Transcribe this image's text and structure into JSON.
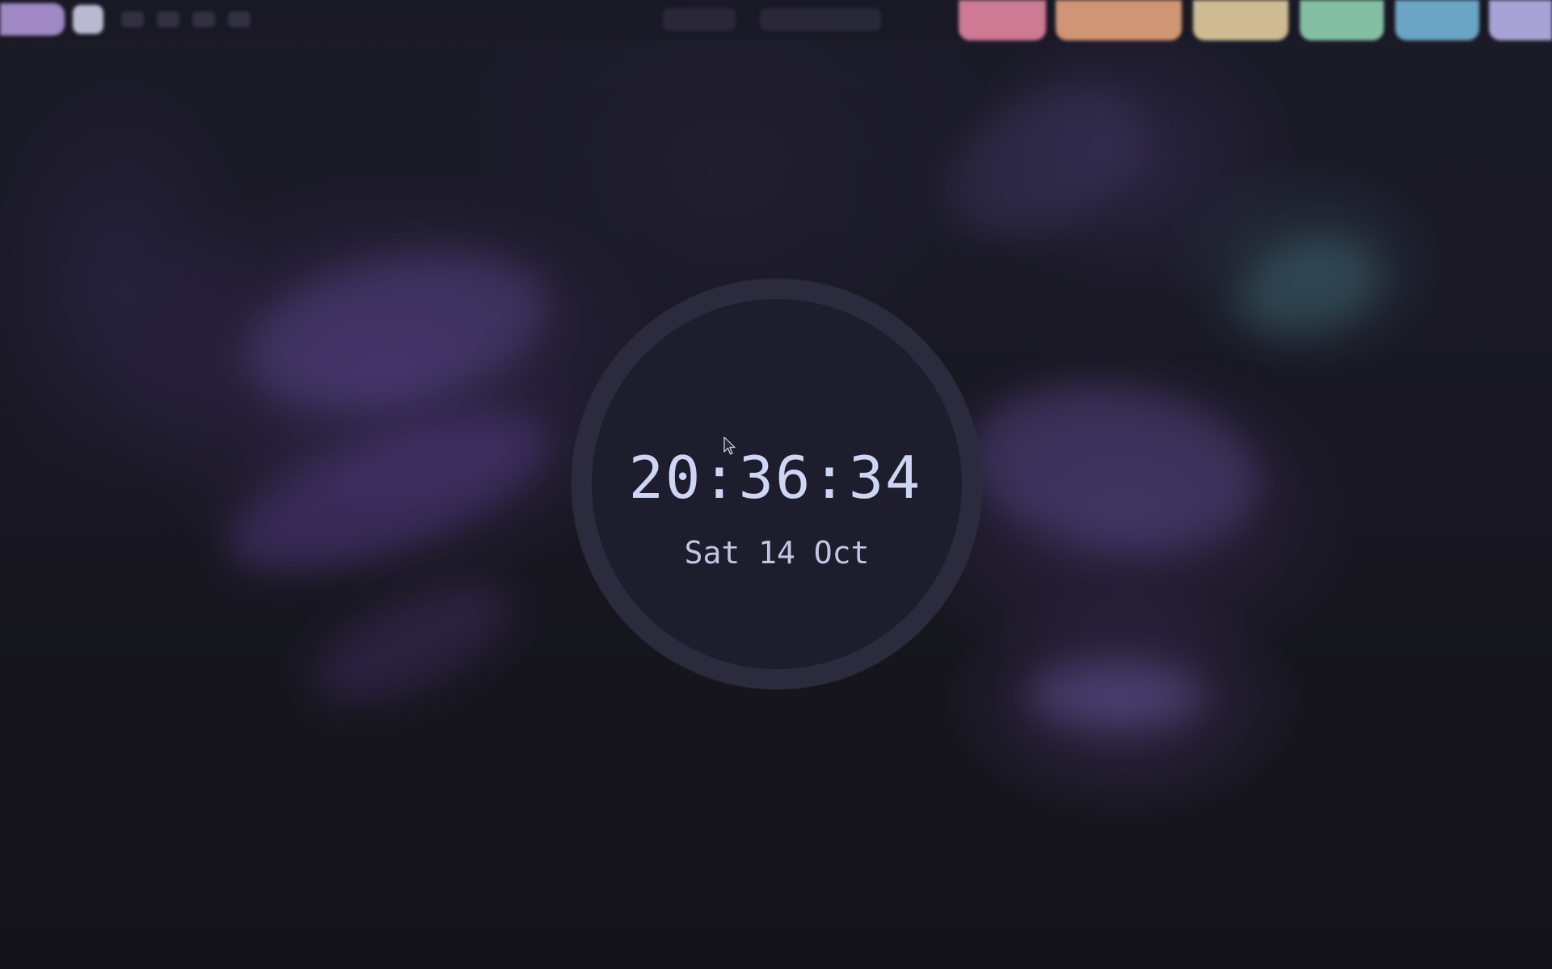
{
  "wallpaper": {
    "description_colors": [
      "#16151f",
      "#5a4690",
      "#3c6a76"
    ]
  },
  "topbar": {
    "launcher_color": "#b79cdf",
    "workspace_active_color": "#d5d7ef",
    "status_colors": {
      "red": "#e688a4",
      "orange": "#e9a77f",
      "yellow": "#e8d1a3",
      "green": "#93d7b5",
      "blue": "#76b9dc",
      "lavender": "#bdb7ee"
    }
  },
  "clock": {
    "time": "20:36:34",
    "date": "Sat 14 Oct",
    "text_color": "#cfd6f4",
    "ring_color": "#2c2b3d",
    "face_color": "#1e1d2d"
  },
  "cursor": {
    "icon": "arrow-cursor-icon"
  }
}
